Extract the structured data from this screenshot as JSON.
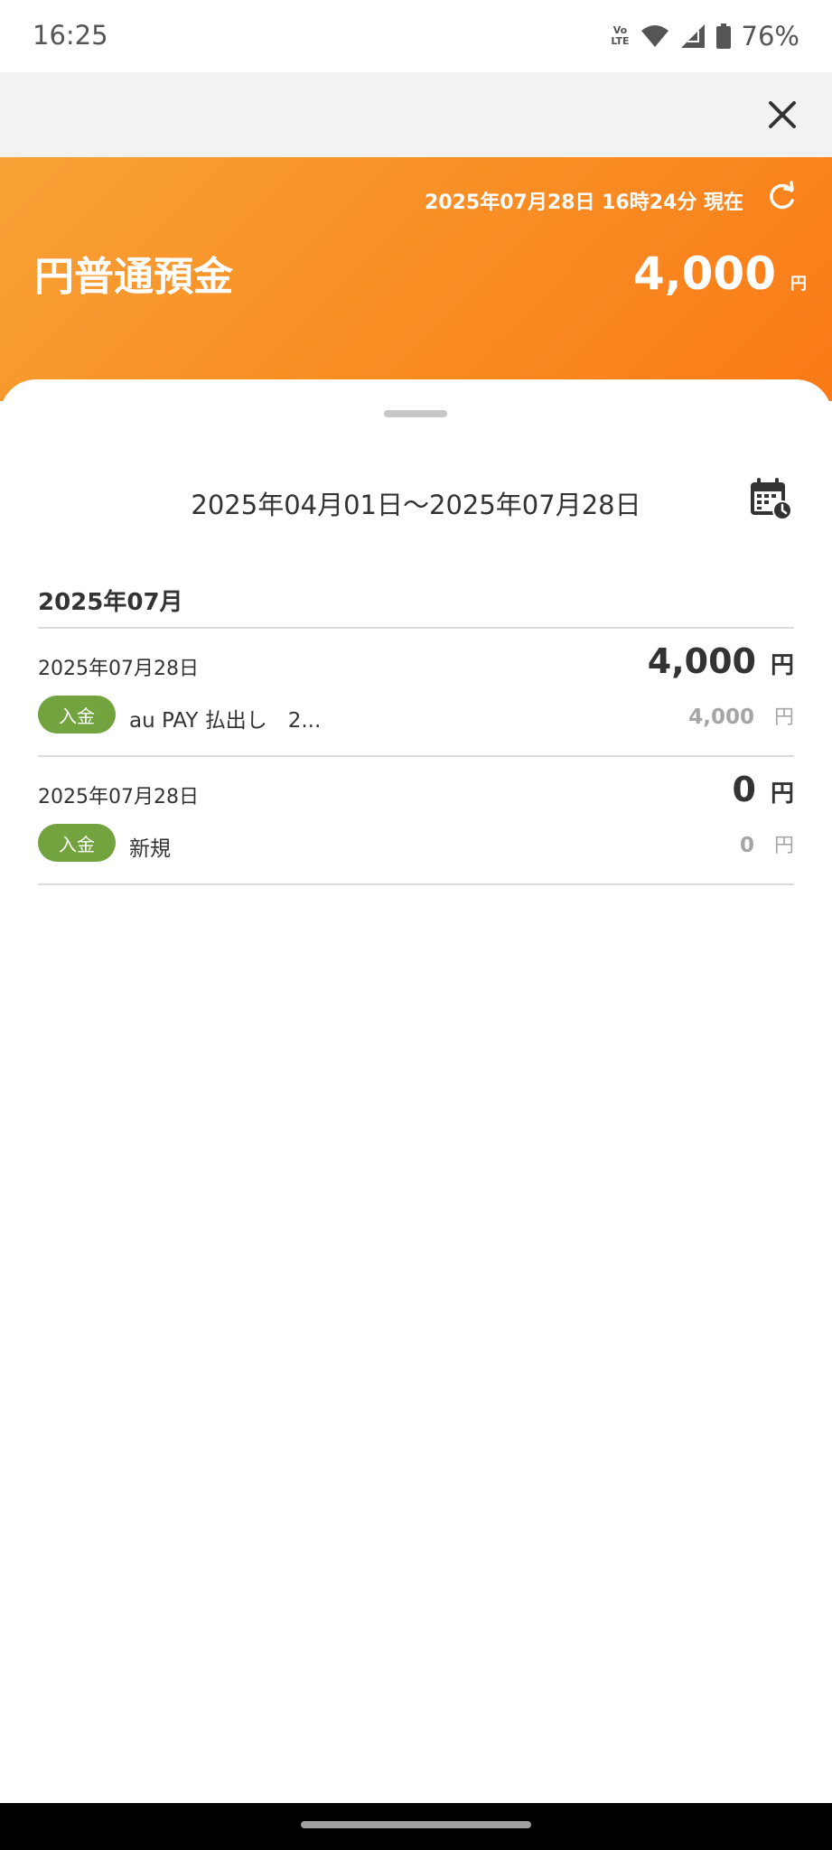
{
  "status_bar": {
    "time": "16:25",
    "volte_top": "Vo",
    "volte_bottom": "LTE",
    "battery_percent": "76%",
    "icons": [
      "volte-icon",
      "wifi-icon",
      "signal-icon",
      "battery-icon"
    ]
  },
  "header": {
    "as_of": "2025年07月28日 16時24分 現在",
    "account_name": "円普通預金",
    "balance": "4,000",
    "balance_unit": "円"
  },
  "history": {
    "period": "2025年04月01日〜2025年07月28日",
    "month": "2025年07月",
    "transactions": [
      {
        "date": "2025年07月28日",
        "amount": "4,000",
        "amount_unit": "円",
        "type": "入金",
        "description": "au PAY 払出し　2...",
        "balance": "4,000",
        "balance_unit": "円"
      },
      {
        "date": "2025年07月28日",
        "amount": "0",
        "amount_unit": "円",
        "type": "入金",
        "description": "新規",
        "balance": "0",
        "balance_unit": "円"
      }
    ]
  },
  "colors": {
    "header_orange_start": "#f7a236",
    "header_orange_end": "#fa7a18",
    "deposit_badge": "#72a33f",
    "balance_gray": "#a5a5a5"
  }
}
